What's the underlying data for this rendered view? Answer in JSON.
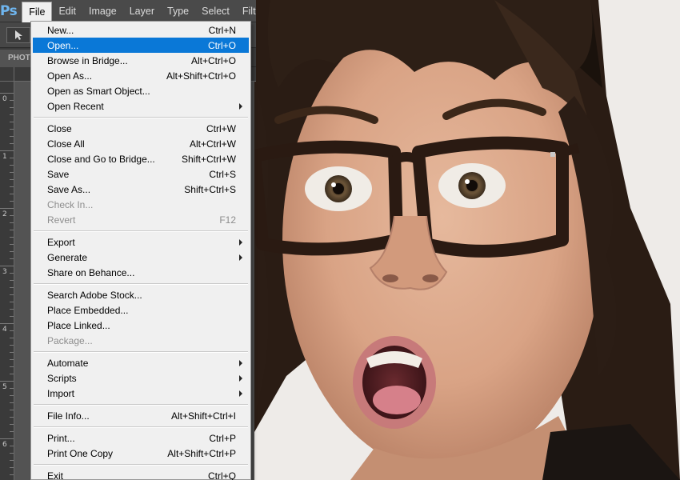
{
  "app": {
    "logo": "Ps"
  },
  "menubar": {
    "items": [
      {
        "label": "File",
        "active": true
      },
      {
        "label": "Edit"
      },
      {
        "label": "Image"
      },
      {
        "label": "Layer"
      },
      {
        "label": "Type"
      },
      {
        "label": "Select"
      },
      {
        "label": "Filt"
      }
    ]
  },
  "options_bar": {
    "tool_icon": "move-tool-icon"
  },
  "document_tab": {
    "label": "PHOTO"
  },
  "vertical_ruler": {
    "labels": [
      "0",
      "1",
      "2",
      "3",
      "4",
      "5",
      "6"
    ]
  },
  "file_menu": {
    "items": [
      {
        "label": "New...",
        "shortcut": "Ctrl+N"
      },
      {
        "label": "Open...",
        "shortcut": "Ctrl+O",
        "highlighted": true
      },
      {
        "label": "Browse in Bridge...",
        "shortcut": "Alt+Ctrl+O"
      },
      {
        "label": "Open As...",
        "shortcut": "Alt+Shift+Ctrl+O"
      },
      {
        "label": "Open as Smart Object...",
        "shortcut": ""
      },
      {
        "label": "Open Recent",
        "shortcut": "",
        "submenu": true
      },
      {
        "separator": true
      },
      {
        "label": "Close",
        "shortcut": "Ctrl+W"
      },
      {
        "label": "Close All",
        "shortcut": "Alt+Ctrl+W"
      },
      {
        "label": "Close and Go to Bridge...",
        "shortcut": "Shift+Ctrl+W"
      },
      {
        "label": "Save",
        "shortcut": "Ctrl+S"
      },
      {
        "label": "Save As...",
        "shortcut": "Shift+Ctrl+S"
      },
      {
        "label": "Check In...",
        "shortcut": "",
        "disabled": true
      },
      {
        "label": "Revert",
        "shortcut": "F12",
        "disabled": true
      },
      {
        "separator": true
      },
      {
        "label": "Export",
        "shortcut": "",
        "submenu": true
      },
      {
        "label": "Generate",
        "shortcut": "",
        "submenu": true
      },
      {
        "label": "Share on Behance...",
        "shortcut": ""
      },
      {
        "separator": true
      },
      {
        "label": "Search Adobe Stock...",
        "shortcut": ""
      },
      {
        "label": "Place Embedded...",
        "shortcut": ""
      },
      {
        "label": "Place Linked...",
        "shortcut": ""
      },
      {
        "label": "Package...",
        "shortcut": "",
        "disabled": true
      },
      {
        "separator": true
      },
      {
        "label": "Automate",
        "shortcut": "",
        "submenu": true
      },
      {
        "label": "Scripts",
        "shortcut": "",
        "submenu": true
      },
      {
        "label": "Import",
        "shortcut": "",
        "submenu": true
      },
      {
        "separator": true
      },
      {
        "label": "File Info...",
        "shortcut": "Alt+Shift+Ctrl+I"
      },
      {
        "separator": true
      },
      {
        "label": "Print...",
        "shortcut": "Ctrl+P"
      },
      {
        "label": "Print One Copy",
        "shortcut": "Alt+Shift+Ctrl+P"
      },
      {
        "separator": true
      },
      {
        "label": "Exit",
        "shortcut": "Ctrl+Q"
      }
    ]
  },
  "colors": {
    "highlight": "#0a78d7",
    "menu_bg": "#f0f0f0",
    "app_bg": "#535353",
    "logo": "#6fb6f0"
  }
}
